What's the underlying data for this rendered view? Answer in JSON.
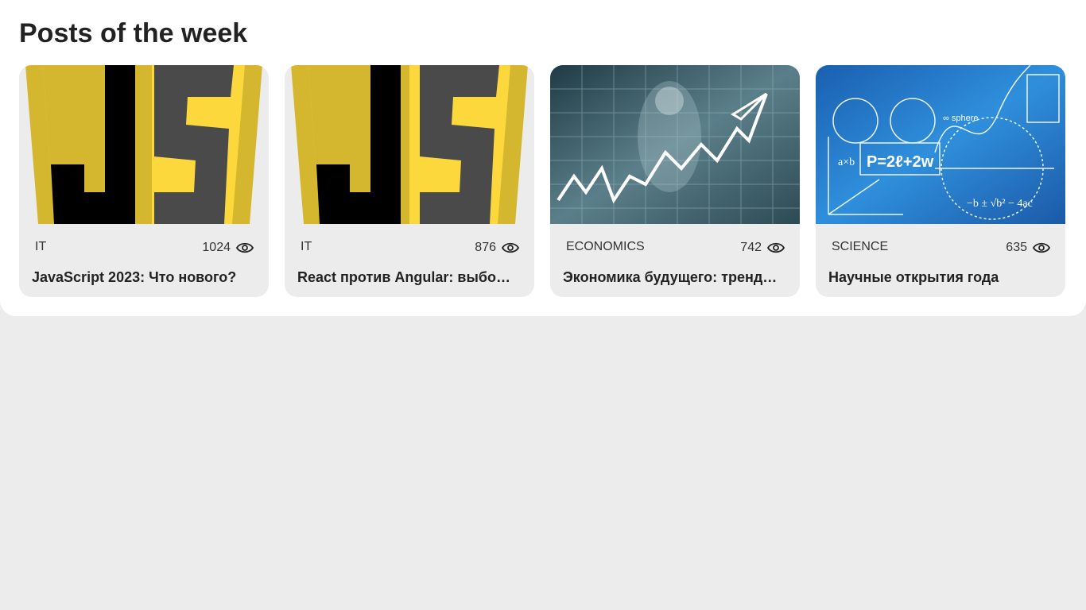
{
  "section_title": "Posts of the week",
  "posts": [
    {
      "category": "IT",
      "views": "1024",
      "title": "JavaScript 2023: Что нового?",
      "image": "javascript-logo"
    },
    {
      "category": "IT",
      "views": "876",
      "title": "React против Angular: выбор фреймворка",
      "image": "javascript-logo"
    },
    {
      "category": "ECONOMICS",
      "views": "742",
      "title": "Экономика будущего: тренды и прогнозы",
      "image": "economics-growth-chart"
    },
    {
      "category": "SCIENCE",
      "views": "635",
      "title": "Научные открытия года",
      "image": "math-formulas-board"
    }
  ],
  "icons": {
    "views": "eye-icon"
  },
  "colors": {
    "page_bg": "#ececec",
    "card_bg": "#ececec",
    "js_yellow": "#f5d12e",
    "js_dark": "#4a4a4a"
  }
}
